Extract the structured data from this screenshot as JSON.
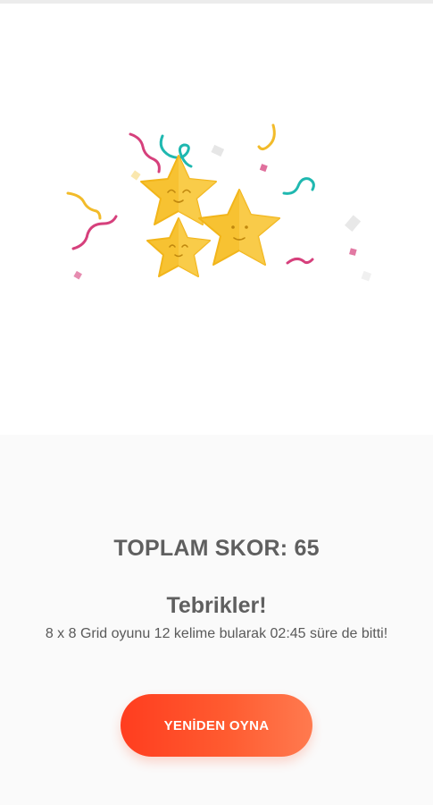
{
  "result": {
    "total_score": "TOPLAM SKOR: 65",
    "congrats_title": "Tebrikler!",
    "summary": "8 x 8 Grid oyunu 12 kelime bularak 02:45 süre de bitti!"
  },
  "actions": {
    "replay_label": "YENİDEN OYNA"
  },
  "illustration": {
    "icon": "celebration-stars-confetti"
  },
  "colors": {
    "button_start": "#ff3d1f",
    "button_end": "#ff7a4f",
    "star": "#f7c232",
    "text": "#5f5f5f"
  }
}
